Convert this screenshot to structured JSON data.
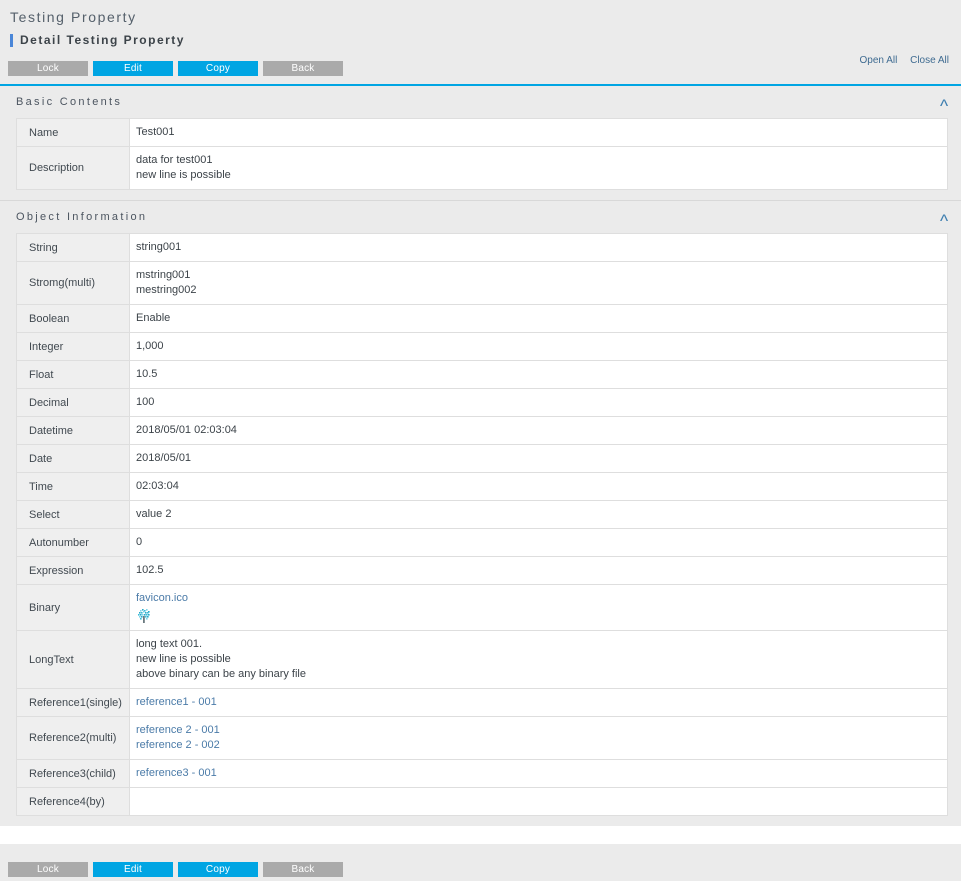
{
  "header": {
    "page_title": "Testing Property",
    "sub_title": "Detail Testing Property"
  },
  "toolbar": {
    "buttons": [
      {
        "label": "Lock",
        "style": "gray"
      },
      {
        "label": "Edit",
        "style": "blue"
      },
      {
        "label": "Copy",
        "style": "blue"
      },
      {
        "label": "Back",
        "style": "gray"
      }
    ],
    "open_all": "Open All",
    "close_all": "Close All"
  },
  "bottom_toolbar": {
    "buttons": [
      {
        "label": "Lock",
        "style": "gray"
      },
      {
        "label": "Edit",
        "style": "blue"
      },
      {
        "label": "Copy",
        "style": "blue"
      },
      {
        "label": "Back",
        "style": "gray"
      }
    ]
  },
  "sections": [
    {
      "title": "Basic Contents",
      "collapse_icon": "ʌ",
      "rows": [
        {
          "label": "Name",
          "values": [
            "Test001"
          ]
        },
        {
          "label": "Description",
          "values": [
            "data for test001",
            "new line is possible"
          ]
        }
      ]
    },
    {
      "title": "Object Information",
      "collapse_icon": "ʌ",
      "rows": [
        {
          "label": "String",
          "values": [
            "string001"
          ]
        },
        {
          "label": "Stromg(multi)",
          "values": [
            "mstring001",
            "mestring002"
          ]
        },
        {
          "label": "Boolean",
          "values": [
            "Enable"
          ]
        },
        {
          "label": "Integer",
          "values": [
            "1,000"
          ]
        },
        {
          "label": "Float",
          "values": [
            "10.5"
          ]
        },
        {
          "label": "Decimal",
          "values": [
            "100"
          ]
        },
        {
          "label": "Datetime",
          "values": [
            "2018/05/01 02:03:04"
          ]
        },
        {
          "label": "Date",
          "values": [
            "2018/05/01"
          ]
        },
        {
          "label": "Time",
          "values": [
            "02:03:04"
          ]
        },
        {
          "label": "Select",
          "values": [
            "value 2"
          ]
        },
        {
          "label": "Autonumber",
          "values": [
            "0"
          ]
        },
        {
          "label": "Expression",
          "values": [
            "102.5"
          ]
        },
        {
          "label": "Binary",
          "values": [
            "favicon.ico"
          ],
          "link": true,
          "thumb": "favicon-tree-icon"
        },
        {
          "label": "LongText",
          "values": [
            "long text 001.",
            "new line is possible",
            "above binary can be any binary file"
          ]
        },
        {
          "label": "Reference1(single)",
          "values": [
            "reference1 - 001"
          ],
          "link": true
        },
        {
          "label": "Reference2(multi)",
          "values": [
            "reference 2 - 001",
            "reference 2 - 002"
          ],
          "link": true
        },
        {
          "label": "Reference3(child)",
          "values": [
            "reference3 - 001"
          ],
          "link": true
        },
        {
          "label": "Reference4(by)",
          "values": []
        }
      ]
    }
  ],
  "colors": {
    "accent_blue": "#00a5e3",
    "title_accent": "#4a86d8",
    "button_gray": "#aaaaaa",
    "link": "#4b7ba8",
    "page_bg": "#ebebeb"
  }
}
